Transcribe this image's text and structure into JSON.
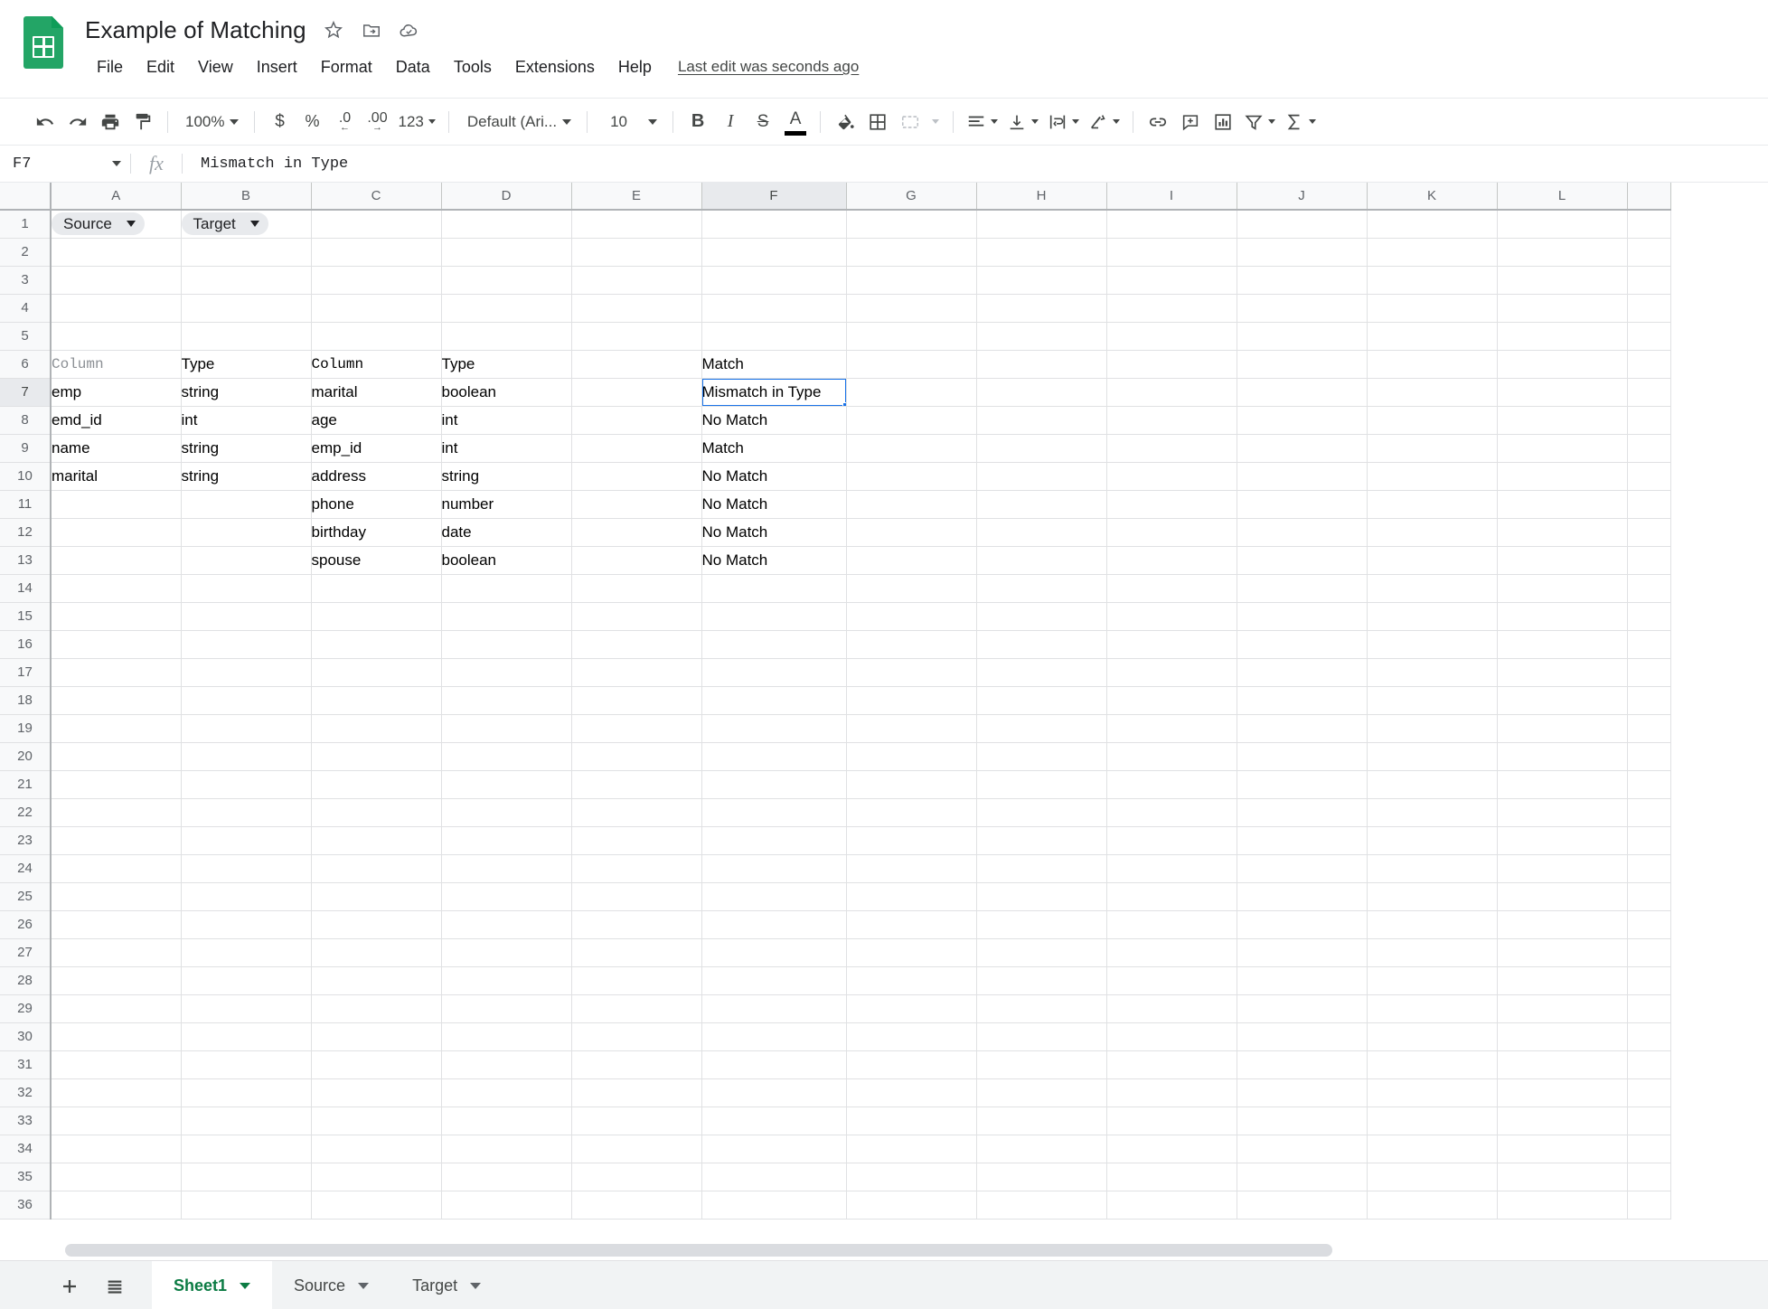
{
  "app": {
    "logo_icon": "sheets-logo-icon"
  },
  "header": {
    "title": "Example of Matching",
    "star_icon": "star-icon",
    "move_icon": "move-to-folder-icon",
    "cloud_icon": "cloud-saved-icon",
    "menus": [
      "File",
      "Edit",
      "View",
      "Insert",
      "Format",
      "Data",
      "Tools",
      "Extensions",
      "Help"
    ],
    "last_edit": "Last edit was seconds ago"
  },
  "toolbar": {
    "undo_icon": "undo-icon",
    "redo_icon": "redo-icon",
    "print_icon": "print-icon",
    "paint_icon": "paint-format-icon",
    "zoom": "100%",
    "currency_icon": "$",
    "percent_icon": "%",
    "decrease_decimal_icon": ".0",
    "increase_decimal_icon": ".00",
    "more_formats": "123",
    "font": "Default (Ari...",
    "font_size": "10",
    "bold": "B",
    "italic": "I",
    "strikethrough": "S",
    "text_color_icon": "A",
    "fill_color_icon": "fill-color-icon",
    "borders_icon": "borders-icon",
    "merge_icon": "merge-cells-icon",
    "halign_icon": "horizontal-align-icon",
    "valign_icon": "vertical-align-icon",
    "wrap_icon": "text-wrap-icon",
    "rotate_icon": "text-rotation-icon",
    "link_icon": "insert-link-icon",
    "comment_icon": "insert-comment-icon",
    "chart_icon": "insert-chart-icon",
    "filter_icon": "filter-icon",
    "functions_icon": "functions-sigma-icon"
  },
  "formula_bar": {
    "name_box": "F7",
    "fx_icon": "fx-icon",
    "content": "Mismatch in Type"
  },
  "grid": {
    "columns": [
      "A",
      "B",
      "C",
      "D",
      "E",
      "F",
      "G",
      "H",
      "I",
      "J",
      "K",
      "L"
    ],
    "active_column": "F",
    "active_row": 7,
    "selected_cell": "F7",
    "row_count": 36,
    "chips": [
      {
        "label": "Source",
        "cell": "A1"
      },
      {
        "label": "Target",
        "cell": "B1"
      }
    ],
    "cells": {
      "A6": "Column",
      "B6": "Type",
      "C6": "Column",
      "D6": "Type",
      "F6": "Match",
      "A7": "emp",
      "B7": "string",
      "C7": "marital",
      "D7": "boolean",
      "F7": "Mismatch in Type",
      "A8": "emd_id",
      "B8": "int",
      "C8": "age",
      "D8": "int",
      "F8": "No Match",
      "A9": "name",
      "B9": "string",
      "C9": "emp_id",
      "D9": "int",
      "F9": "Match",
      "A10": "marital",
      "B10": "string",
      "C10": "address",
      "D10": "string",
      "F10": "No Match",
      "C11": "phone",
      "D11": "number",
      "F11": "No Match",
      "C12": "birthday",
      "D12": "date",
      "F12": "No Match",
      "C13": "spouse",
      "D13": "boolean",
      "F13": "No Match"
    }
  },
  "sheetbar": {
    "add_icon": "add-sheet-icon",
    "all_sheets_icon": "all-sheets-icon",
    "tabs": [
      {
        "label": "Sheet1",
        "active": true
      },
      {
        "label": "Source",
        "active": false
      },
      {
        "label": "Target",
        "active": false
      }
    ]
  },
  "colors": {
    "brand_green": "#0f9d58",
    "selection_blue": "#1a73e8",
    "active_tab_green": "#0b7b43"
  }
}
